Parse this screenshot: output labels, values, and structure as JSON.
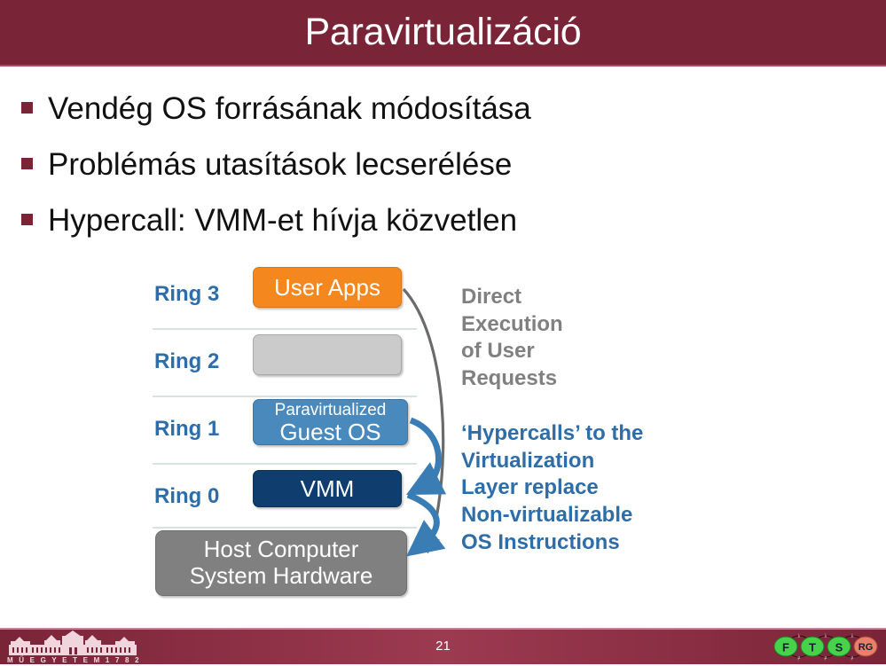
{
  "slide": {
    "title": "Paravirtualizáció",
    "page_number": "21",
    "header_color": "#7A2438",
    "bullet_color": "#7A2438"
  },
  "bullets": [
    {
      "text": "Vendég OS forrásának módosítása"
    },
    {
      "text": "Problémás utasítások lecserélése"
    },
    {
      "text": "Hypercall: VMM-et hívja közvetlen"
    }
  ],
  "diagram": {
    "rings": [
      {
        "label": "Ring 3",
        "box_label": "User Apps",
        "box_color": "#F5871F"
      },
      {
        "label": "Ring 2",
        "box_label": "",
        "box_color": "#CBCBCB"
      },
      {
        "label": "Ring 1",
        "box_label_small": "Paravirtualized",
        "box_label_big": "Guest OS",
        "box_color": "#4A89BC"
      },
      {
        "label": "Ring 0",
        "box_label": "VMM",
        "box_color": "#0E3D6E"
      }
    ],
    "hardware": {
      "line1": "Host Computer",
      "line2": "System Hardware",
      "color": "#808080"
    },
    "annotations": [
      {
        "text": "Direct\nExecution\nof User\nRequests",
        "color": "#808080"
      },
      {
        "text": "‘Hypercalls’ to the\nVirtualization\nLayer replace\nNon-virtualizable\nOS Instructions",
        "color": "#2E6DA8"
      }
    ],
    "arrow_colors": {
      "direct_execution": "#6B6B6B",
      "hypercall": "#3A7CB4"
    }
  },
  "footer": {
    "university_logo_text": "M Ű E G Y E T E M   1 7 8 2",
    "research_group_nodes": [
      "F",
      "T",
      "S",
      "RG"
    ],
    "research_group_arc_labels": {
      "top": "λ",
      "bottom": "μ"
    }
  }
}
